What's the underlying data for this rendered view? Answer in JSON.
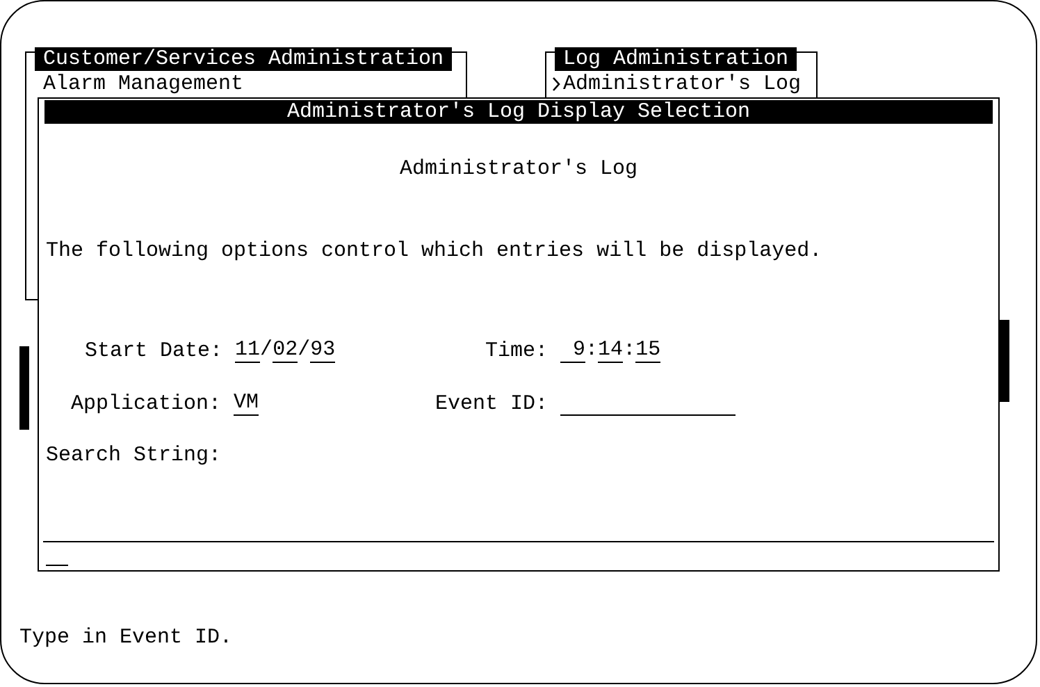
{
  "menus": [
    {
      "title": "Customer/Services Administration",
      "items": [
        {
          "label": "Alarm Management",
          "selected": false
        }
      ]
    },
    {
      "title": "Log Administration",
      "items": [
        {
          "label": "Administrator's Log",
          "selected": true
        }
      ]
    }
  ],
  "dialog": {
    "title": "Administrator's Log Display Selection",
    "heading": "Administrator's Log",
    "description": "The following options control which entries will be displayed.",
    "rows": [
      [
        {
          "label": "Start Date:",
          "value": [
            {
              "kind": "entry",
              "text": "11"
            },
            {
              "kind": "sep",
              "text": "/"
            },
            {
              "kind": "entry",
              "text": "02"
            },
            {
              "kind": "sep",
              "text": "/"
            },
            {
              "kind": "entry",
              "text": "93"
            }
          ]
        },
        {
          "label": "Time:",
          "value": [
            {
              "kind": "entry",
              "text": " 9"
            },
            {
              "kind": "sep",
              "text": ":"
            },
            {
              "kind": "entry",
              "text": "14"
            },
            {
              "kind": "sep",
              "text": ":"
            },
            {
              "kind": "entry",
              "text": "15"
            }
          ]
        }
      ],
      [
        {
          "label": "Application:",
          "value": [
            {
              "kind": "entry",
              "text": "VM"
            }
          ]
        },
        {
          "label": "Event ID:",
          "value": [
            {
              "kind": "blank"
            }
          ]
        }
      ],
      [
        {
          "label": "Search String:"
        }
      ]
    ]
  },
  "status_bar": "Type in Event ID."
}
